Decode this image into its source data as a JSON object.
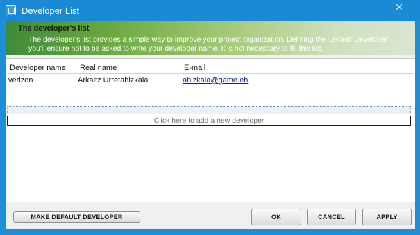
{
  "window": {
    "title": "Developer List",
    "close_glyph": "✕",
    "title_icon": "app-window-icon"
  },
  "header": {
    "title": "The developer's list",
    "description": "The developer's list provides a simple way to improve your project organization. Defining the 'Default Developer' you'll ensure not to be asked to write your developer name. It is not necessary to fill this list."
  },
  "list": {
    "columns": [
      "Developer name",
      "Real name",
      "E-mail"
    ],
    "rows": [
      {
        "developer_name": "verizon",
        "real_name": "Arkaitz Urretabizkaia",
        "email": "abizkaia@game.eh"
      }
    ],
    "add_prompt": "Click here to add a new developer"
  },
  "buttons": {
    "make_default": "MAKE DEFAULT DEVELOPER",
    "ok": "OK",
    "cancel": "CANCEL",
    "apply": "APPLY"
  },
  "colors": {
    "title_bar": "#1a8ad4",
    "header_gradient_start": "#3d8a3a",
    "header_gradient_end": "#d9e6d3",
    "link": "#0a2a8a"
  }
}
